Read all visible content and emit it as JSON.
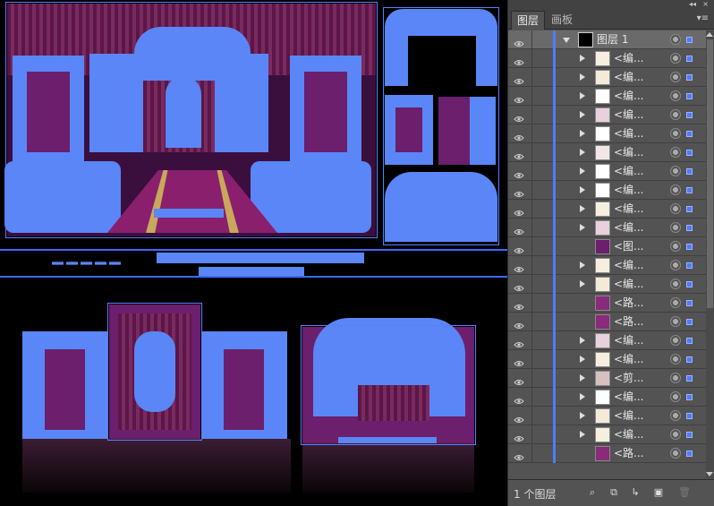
{
  "panel": {
    "top_controls": {
      "collapse": "◂◂",
      "close": "×"
    },
    "tabs": [
      {
        "label": "图层",
        "active": true
      },
      {
        "label": "画板",
        "active": false
      }
    ],
    "tab_menu_icon": "panel-menu-icon",
    "layer_group": {
      "name": "图层 1"
    },
    "layers": [
      {
        "name": "<编...",
        "expandable": true
      },
      {
        "name": "<编...",
        "expandable": true
      },
      {
        "name": "<编...",
        "expandable": true
      },
      {
        "name": "<编...",
        "expandable": true
      },
      {
        "name": "<编...",
        "expandable": true
      },
      {
        "name": "<编...",
        "expandable": true
      },
      {
        "name": "<编...",
        "expandable": true
      },
      {
        "name": "<编...",
        "expandable": true
      },
      {
        "name": "<编...",
        "expandable": true
      },
      {
        "name": "<编...",
        "expandable": true
      },
      {
        "name": "<图...",
        "expandable": false
      },
      {
        "name": "<编...",
        "expandable": true
      },
      {
        "name": "<编...",
        "expandable": true
      },
      {
        "name": "<路...",
        "expandable": false
      },
      {
        "name": "<路...",
        "expandable": false
      },
      {
        "name": "<编...",
        "expandable": true
      },
      {
        "name": "<编...",
        "expandable": true
      },
      {
        "name": "<剪...",
        "expandable": true
      },
      {
        "name": "<编...",
        "expandable": true
      },
      {
        "name": "<编...",
        "expandable": true
      },
      {
        "name": "<编...",
        "expandable": true
      },
      {
        "name": "<路...",
        "expandable": false
      }
    ],
    "footer": {
      "count_label": "1 个图层",
      "icons": [
        "locate-object-icon",
        "make-clipping-mask-icon",
        "new-sublayer-icon",
        "new-layer-icon",
        "delete-layer-icon"
      ]
    }
  },
  "colors": {
    "selection_blue": "#5a86f7",
    "stage_purple": "#6b1f6d",
    "panel_bg": "#535353"
  }
}
